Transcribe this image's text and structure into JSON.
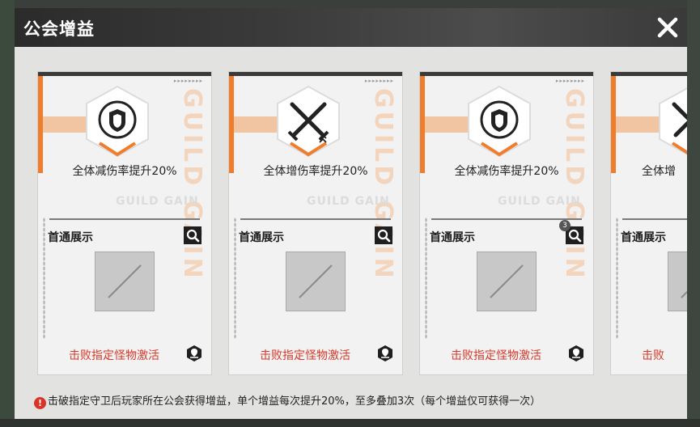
{
  "dialog": {
    "title": "公会增益",
    "close_icon": "close-icon"
  },
  "cards": [
    {
      "effect": "全体减伤率提升20%",
      "icon": "shield-emblem-icon",
      "first_clear_label": "首通展示",
      "activate_text": "击败指定怪物激活",
      "watermark_h": "GUILD GAIN",
      "watermark_v": "GUILD GAIN",
      "badge": ""
    },
    {
      "effect": "全体增伤率提升20%",
      "icon": "crossed-swords-icon",
      "first_clear_label": "首通展示",
      "activate_text": "击败指定怪物激活",
      "watermark_h": "GUILD GAIN",
      "watermark_v": "GUILD GAIN",
      "badge": ""
    },
    {
      "effect": "全体减伤率提升20%",
      "icon": "shield-emblem-icon",
      "first_clear_label": "首通展示",
      "activate_text": "击败指定怪物激活",
      "watermark_h": "GUILD GAIN",
      "watermark_v": "GUILD GAIN",
      "badge": "3"
    },
    {
      "effect": "全体增",
      "icon": "crossed-swords-icon",
      "first_clear_label": "首通展示",
      "activate_text": "击败",
      "watermark_h": "",
      "watermark_v": "",
      "badge": ""
    }
  ],
  "footer": {
    "notice": "击破指定守卫后玩家所在公会获得增益，单个增益每次提升20%，至多叠加3次（每个增益仅可获得一次）",
    "warning_icon": "warning-icon"
  },
  "colors": {
    "accent_orange": "#f07d2c",
    "activate_red": "#d63a2a",
    "title_bar": "#333333"
  }
}
